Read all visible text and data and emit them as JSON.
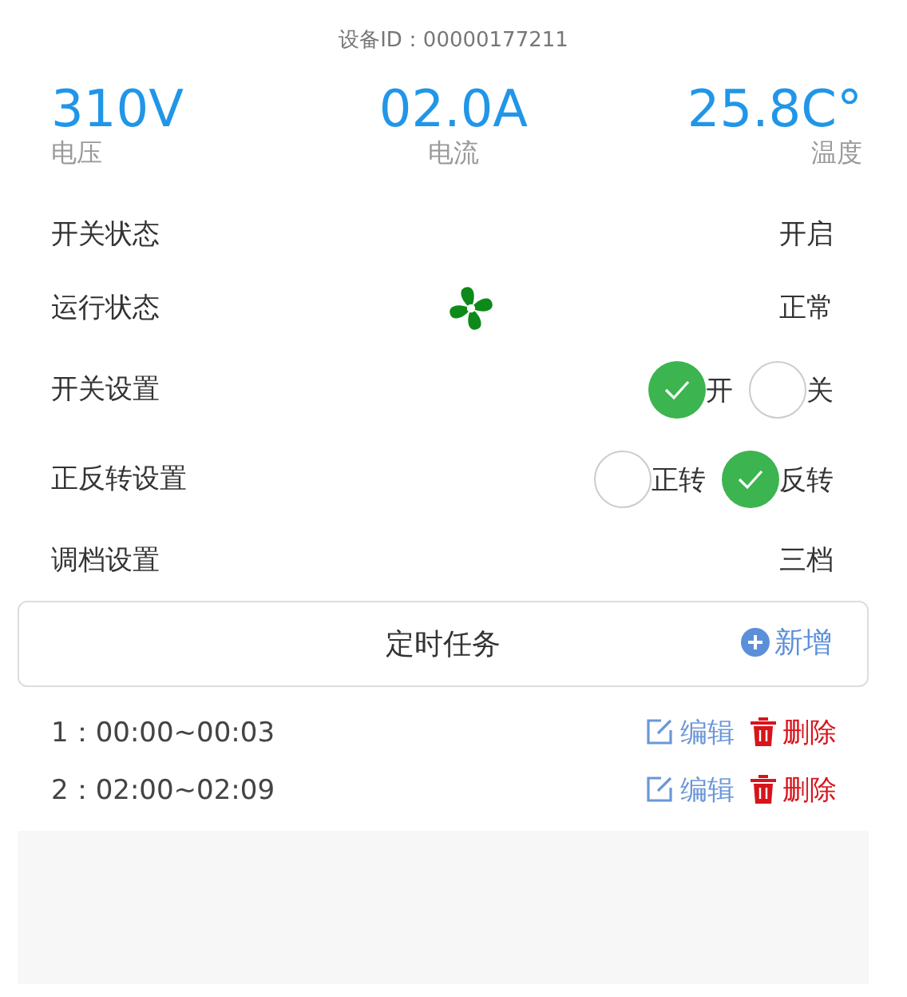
{
  "device_id": "设备ID：00000177211",
  "readings": [
    {
      "value": "310V",
      "label": "电压"
    },
    {
      "value": "02.0A",
      "label": "电流"
    },
    {
      "value": "25.8C°",
      "label": "温度"
    }
  ],
  "rows": [
    {
      "kind": "text",
      "label": "开关状态",
      "value": "开启"
    },
    {
      "kind": "icon",
      "label": "运行状态",
      "value": "正常"
    },
    {
      "kind": "radio",
      "label": "开关设置",
      "options": [
        {
          "label": "开",
          "selected": true
        },
        {
          "label": "关",
          "selected": false
        }
      ]
    },
    {
      "kind": "radio",
      "label": "正反转设置",
      "options": [
        {
          "label": "正转",
          "selected": false
        },
        {
          "label": "反转",
          "selected": true
        }
      ]
    },
    {
      "kind": "text",
      "label": "调档设置",
      "value": "三档"
    }
  ],
  "timer": {
    "title": "定时任务",
    "add": "新增",
    "tasks": [
      {
        "text": "1：00:00~00:03",
        "edit": "编辑",
        "delete": "删除"
      },
      {
        "text": "2：02:00~02:09",
        "edit": "编辑",
        "delete": "删除"
      }
    ]
  }
}
